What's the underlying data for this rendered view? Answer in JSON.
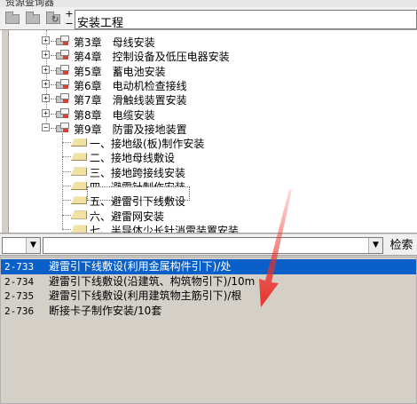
{
  "window": {
    "title": "资源查询器"
  },
  "toolbar": {
    "buttons": [
      {
        "name": "open-folder-icon"
      },
      {
        "name": "folder-icon"
      },
      {
        "name": "folder-refresh-icon"
      }
    ],
    "expand_label": "+",
    "collapse_label": "−",
    "root_name": "安装工程"
  },
  "tree": {
    "chapters": [
      {
        "label": "第3章　母线安装",
        "expanded": false
      },
      {
        "label": "第4章　控制设备及低压电器安装",
        "expanded": false
      },
      {
        "label": "第5章　蓄电池安装",
        "expanded": false
      },
      {
        "label": "第6章　电动机检查接线",
        "expanded": false
      },
      {
        "label": "第7章　滑触线装置安装",
        "expanded": false
      },
      {
        "label": "第8章　电缆安装",
        "expanded": false
      },
      {
        "label": "第9章　防雷及接地装置",
        "expanded": true
      }
    ],
    "sections": [
      {
        "label": "一、接地级(板)制作安装"
      },
      {
        "label": "二、接地母线敷设"
      },
      {
        "label": "三、接地跨接线安装"
      },
      {
        "label": "四、避雷针制作安装"
      },
      {
        "label": "五、避雷引下线敷设",
        "focused": true
      },
      {
        "label": "六、避雷网安装"
      },
      {
        "label": "七、半导体少长针消雷装置安装"
      }
    ]
  },
  "search": {
    "category_value": "",
    "keyword_value": "",
    "button_label": "检索"
  },
  "results": [
    {
      "code": "2-733",
      "name": "避雷引下线敷设(利用金属构件引下)/处",
      "selected": true
    },
    {
      "code": "2-734",
      "name": "避雷引下线敷设(沿建筑、构筑物引下)/10m",
      "selected": false
    },
    {
      "code": "2-735",
      "name": "避雷引下线敷设(利用建筑物主筋引下)/根",
      "selected": false
    },
    {
      "code": "2-736",
      "name": "断接卡子制作安装/10套",
      "selected": false
    }
  ],
  "annotation": {
    "arrow_color": "#e8312a"
  }
}
